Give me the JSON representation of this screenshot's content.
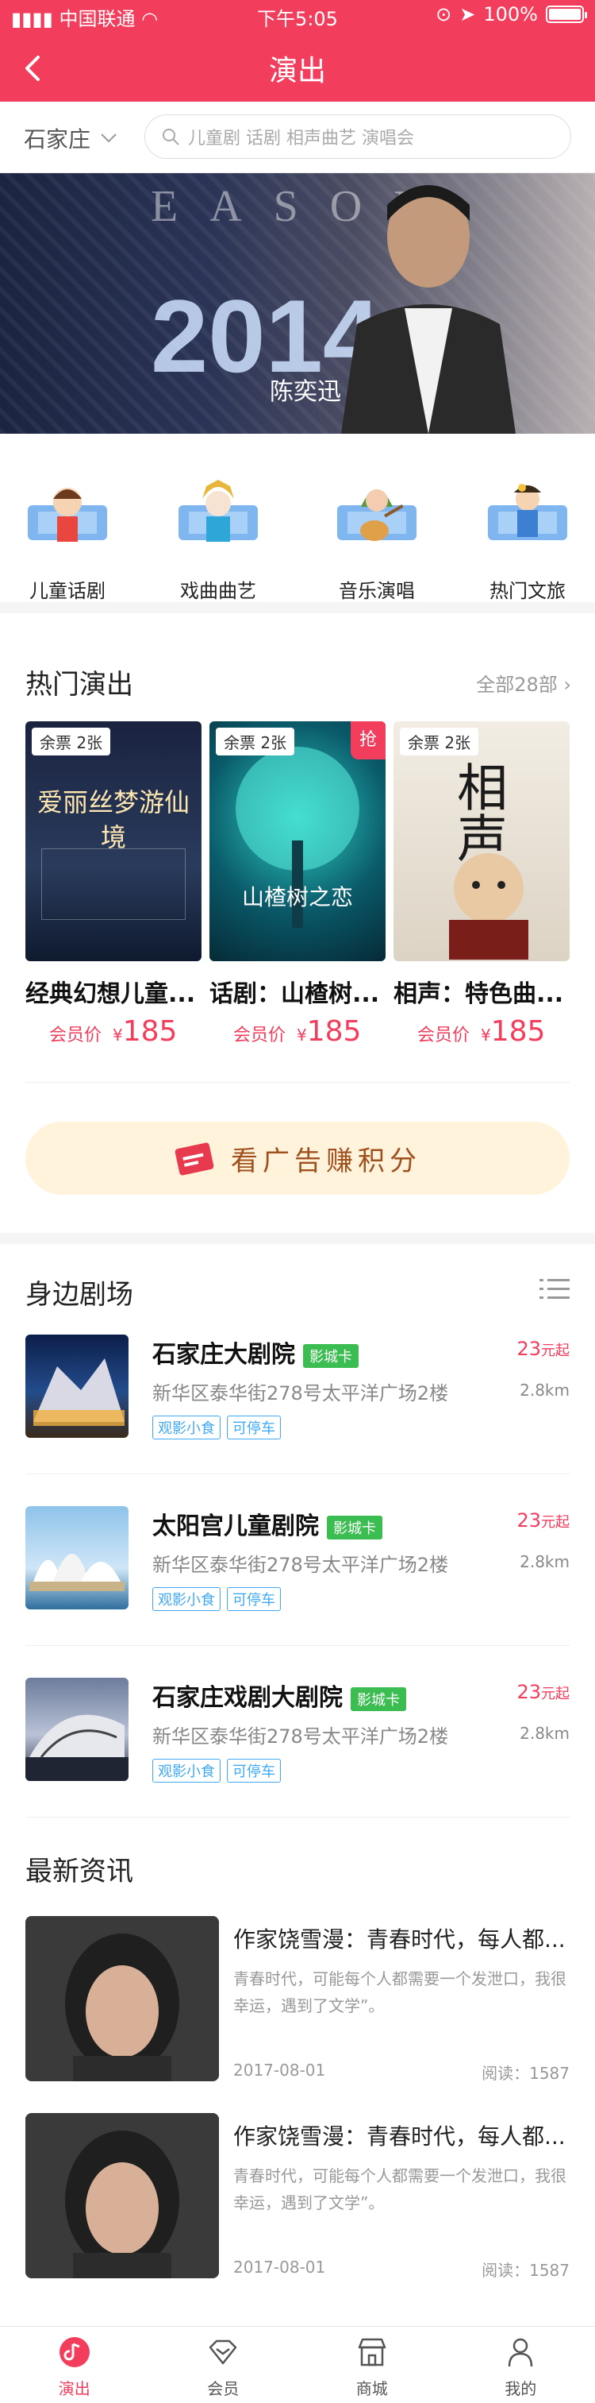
{
  "status": {
    "carrier": "中国联通",
    "time": "下午5:05",
    "battery": "100%"
  },
  "nav": {
    "title": "演出"
  },
  "search": {
    "city": "石家庄",
    "placeholder": "儿童剧  话剧  相声曲艺  演唱会"
  },
  "banner": {
    "headline": "EASON",
    "subtitle": "陈奕迅",
    "year": "2014"
  },
  "categories": [
    {
      "label": "儿童话剧",
      "icon": "child-drama-icon"
    },
    {
      "label": "戏曲曲艺",
      "icon": "opera-icon"
    },
    {
      "label": "音乐演唱",
      "icon": "music-icon"
    },
    {
      "label": "热门文旅",
      "icon": "travel-icon"
    }
  ],
  "hot": {
    "title": "热门演出",
    "more": "全部28部",
    "shows": [
      {
        "tag": "余票 2张",
        "rush": "",
        "title": "经典幻想儿童...",
        "price_label": "会员价",
        "price_symbol": "¥",
        "price": "185",
        "poster_title": "爱丽丝梦游仙境"
      },
      {
        "tag": "余票 2张",
        "rush": "抢",
        "title": "话剧：山楂树...",
        "price_label": "会员价",
        "price_symbol": "¥",
        "price": "185",
        "poster_title": "山楂树之恋"
      },
      {
        "tag": "余票 2张",
        "rush": "",
        "title": "相声：特色曲...",
        "price_label": "会员价",
        "price_symbol": "¥",
        "price": "185",
        "poster_title": "相声"
      }
    ]
  },
  "ad": {
    "text": "看广告赚积分"
  },
  "nearby": {
    "title": "身边剧场",
    "theatres": [
      {
        "name": "石家庄大剧院",
        "badge": "影城卡",
        "price": "23",
        "price_unit": "元起",
        "address": "新华区泰华街278号太平洋广场2楼",
        "distance": "2.8km",
        "chips": [
          "观影小食",
          "可停车"
        ]
      },
      {
        "name": "太阳宫儿童剧院",
        "badge": "影城卡",
        "price": "23",
        "price_unit": "元起",
        "address": "新华区泰华街278号太平洋广场2楼",
        "distance": "2.8km",
        "chips": [
          "观影小食",
          "可停车"
        ]
      },
      {
        "name": "石家庄戏剧大剧院",
        "badge": "影城卡",
        "price": "23",
        "price_unit": "元起",
        "address": "新华区泰华街278号太平洋广场2楼",
        "distance": "2.8km",
        "chips": [
          "观影小食",
          "可停车"
        ]
      }
    ]
  },
  "news": {
    "title": "最新资讯",
    "items": [
      {
        "title": "作家饶雪漫：青春时代，每人都...",
        "summary": "青春时代，可能每个人都需要一个发泄口，我很幸运，遇到了文学”。",
        "date": "2017-08-01",
        "reads": "阅读：1587"
      },
      {
        "title": "作家饶雪漫：青春时代，每人都...",
        "summary": "青春时代，可能每个人都需要一个发泄口，我很幸运，遇到了文学”。",
        "date": "2017-08-01",
        "reads": "阅读：1587"
      }
    ]
  },
  "tabbar": [
    {
      "label": "演出",
      "icon": "performance-icon",
      "active": true
    },
    {
      "label": "会员",
      "icon": "member-icon",
      "active": false
    },
    {
      "label": "商城",
      "icon": "store-icon",
      "active": false
    },
    {
      "label": "我的",
      "icon": "profile-icon",
      "active": false
    }
  ],
  "colors": {
    "accent": "#f23d5c",
    "badge_green": "#3cbd52",
    "chip_blue": "#3fa9f5",
    "ad_bg": "#fff3dc"
  }
}
